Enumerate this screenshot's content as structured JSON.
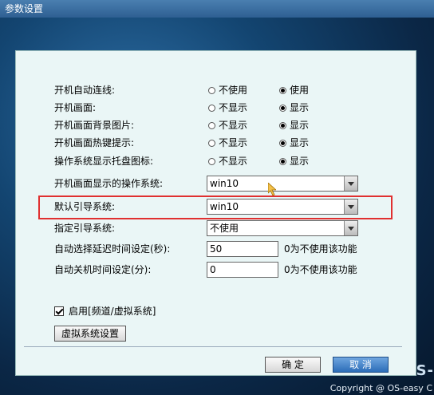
{
  "window": {
    "title": "参数设置"
  },
  "settings": [
    {
      "label": "开机自动连线:",
      "off": "不使用",
      "on": "使用",
      "selected": "on"
    },
    {
      "label": "开机画面:",
      "off": "不显示",
      "on": "显示",
      "selected": "on"
    },
    {
      "label": "开机画面背景图片:",
      "off": "不显示",
      "on": "显示",
      "selected": "on"
    },
    {
      "label": "开机画面热键提示:",
      "off": "不显示",
      "on": "显示",
      "selected": "on"
    },
    {
      "label": "操作系统显示托盘图标:",
      "off": "不显示",
      "on": "显示",
      "selected": "on"
    }
  ],
  "selects": {
    "boot_os_display": {
      "label": "开机画面显示的操作系统:",
      "value": "win10"
    },
    "default_boot": {
      "label": "默认引导系统:",
      "value": "win10"
    },
    "specified_boot": {
      "label": "指定引导系统:",
      "value": "不使用"
    }
  },
  "inputs": {
    "auto_select_delay": {
      "label": "自动选择延迟时间设定(秒):",
      "value": "50",
      "hint": "0为不使用该功能"
    },
    "auto_shutdown": {
      "label": "自动关机时间设定(分):",
      "value": "0",
      "hint": "0为不使用该功能"
    }
  },
  "enable_virtual": {
    "label": "启用[频道/虚拟系统]",
    "checked": true
  },
  "buttons": {
    "virtual_settings": "虚拟系统设置",
    "ok": "确  定",
    "cancel": "取  消"
  },
  "footer": {
    "copyright": "Copyright @ OS-easy C",
    "brand": "S-"
  }
}
